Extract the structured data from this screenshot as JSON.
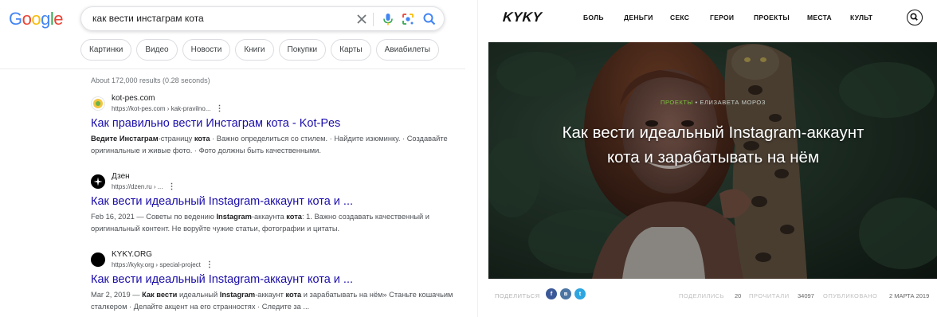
{
  "google": {
    "logo_letters": [
      "G",
      "o",
      "o",
      "g",
      "l",
      "e"
    ],
    "search_query": "как вести инстаграм кота",
    "icons": [
      "clear-icon",
      "mic-icon",
      "lens-icon",
      "search-icon"
    ],
    "chips": [
      "Картинки",
      "Видео",
      "Новости",
      "Книги",
      "Покупки",
      "Карты",
      "Авиабилеты"
    ],
    "stats": "About 172,000 results (0.28 seconds)",
    "results": [
      {
        "site": "kot-pes.com",
        "url": "https://kot-pes.com › kak-pravilno...",
        "title": "Как правильно вести Инстаграм кота - Kot-Pes",
        "snippet_parts": [
          {
            "t": "Инстаграм",
            "b": true
          },
          {
            "t": "-страницу ",
            "b": false
          },
          {
            "t": "кота",
            "b": true
          },
          {
            "t": " · Важно определиться со стилем. · Найдите изюминку. · Создавайте оригинальные и живые фото. · Фото должны быть качественными.",
            "b": false
          }
        ],
        "snippet_lead": "Ведите ",
        "favicon_color": "#f4c542"
      },
      {
        "site": "Дзен",
        "url": "https://dzen.ru › ...",
        "title": "Как вести идеальный Instagram-аккаунт кота и ...",
        "snippet_lead": "Feb 16, 2021 — Советы по ведению ",
        "snippet_parts": [
          {
            "t": "Instagram",
            "b": true
          },
          {
            "t": "-аккаунта ",
            "b": false
          },
          {
            "t": "кота",
            "b": true
          },
          {
            "t": ": 1. Важно создавать качественный и оригинальный контент. Не воруйте чужие статьи, фотографии и цитаты.",
            "b": false
          }
        ],
        "favicon_color": "#000000"
      },
      {
        "site": "KYKY.ORG",
        "url": "https://kyky.org › special-project",
        "title": "Как вести идеальный Instagram-аккаунт кота и ...",
        "snippet_lead": "Mar 2, 2019 — ",
        "snippet_parts": [
          {
            "t": "Как вести",
            "b": true
          },
          {
            "t": " идеальный ",
            "b": false
          },
          {
            "t": "Instagram",
            "b": true
          },
          {
            "t": "-аккаунт ",
            "b": false
          },
          {
            "t": "кота",
            "b": true
          },
          {
            "t": " и зарабатывать на нём» Станьте кошачьим сталкером · Делайте акцент на его странностях · Следите за ...",
            "b": false
          }
        ],
        "favicon_color": "#000000"
      }
    ],
    "colors": {
      "link": "#1a0dab",
      "snippet": "#4d5156"
    }
  },
  "kyky": {
    "logo": "KYKY",
    "nav": [
      "БОЛЬ",
      "ДЕНЬГИ",
      "СЕКС",
      "ГЕРОИ",
      "ПРОЕКТЫ",
      "МЕСТА",
      "КУЛЬТ"
    ],
    "category": "ПРОЕКТЫ",
    "author": " • ЕЛИЗАВЕТА МОРОЗ",
    "headline_line1": "Как вести идеальный Instagram-аккаунт",
    "headline_line2": "кота и зарабатывать на нём",
    "share_label": "ПОДЕЛИТЬСЯ",
    "social": [
      {
        "label": "f",
        "color": "#3b5998",
        "icon": "facebook-icon"
      },
      {
        "label": "в",
        "color": "#4c75a3",
        "icon": "vk-icon"
      },
      {
        "label": "t",
        "color": "#2ca5e0",
        "icon": "telegram-icon"
      }
    ],
    "stats": [
      {
        "label": "ПОДЕЛИЛИСЬ",
        "value": "20"
      },
      {
        "label": "ПРОЧИТАЛИ",
        "value": "34097"
      },
      {
        "label": "ОПУБЛИКОВАНО",
        "value": "2 МАРТА 2019"
      }
    ],
    "colors": {
      "category": "#7cc83c"
    }
  }
}
